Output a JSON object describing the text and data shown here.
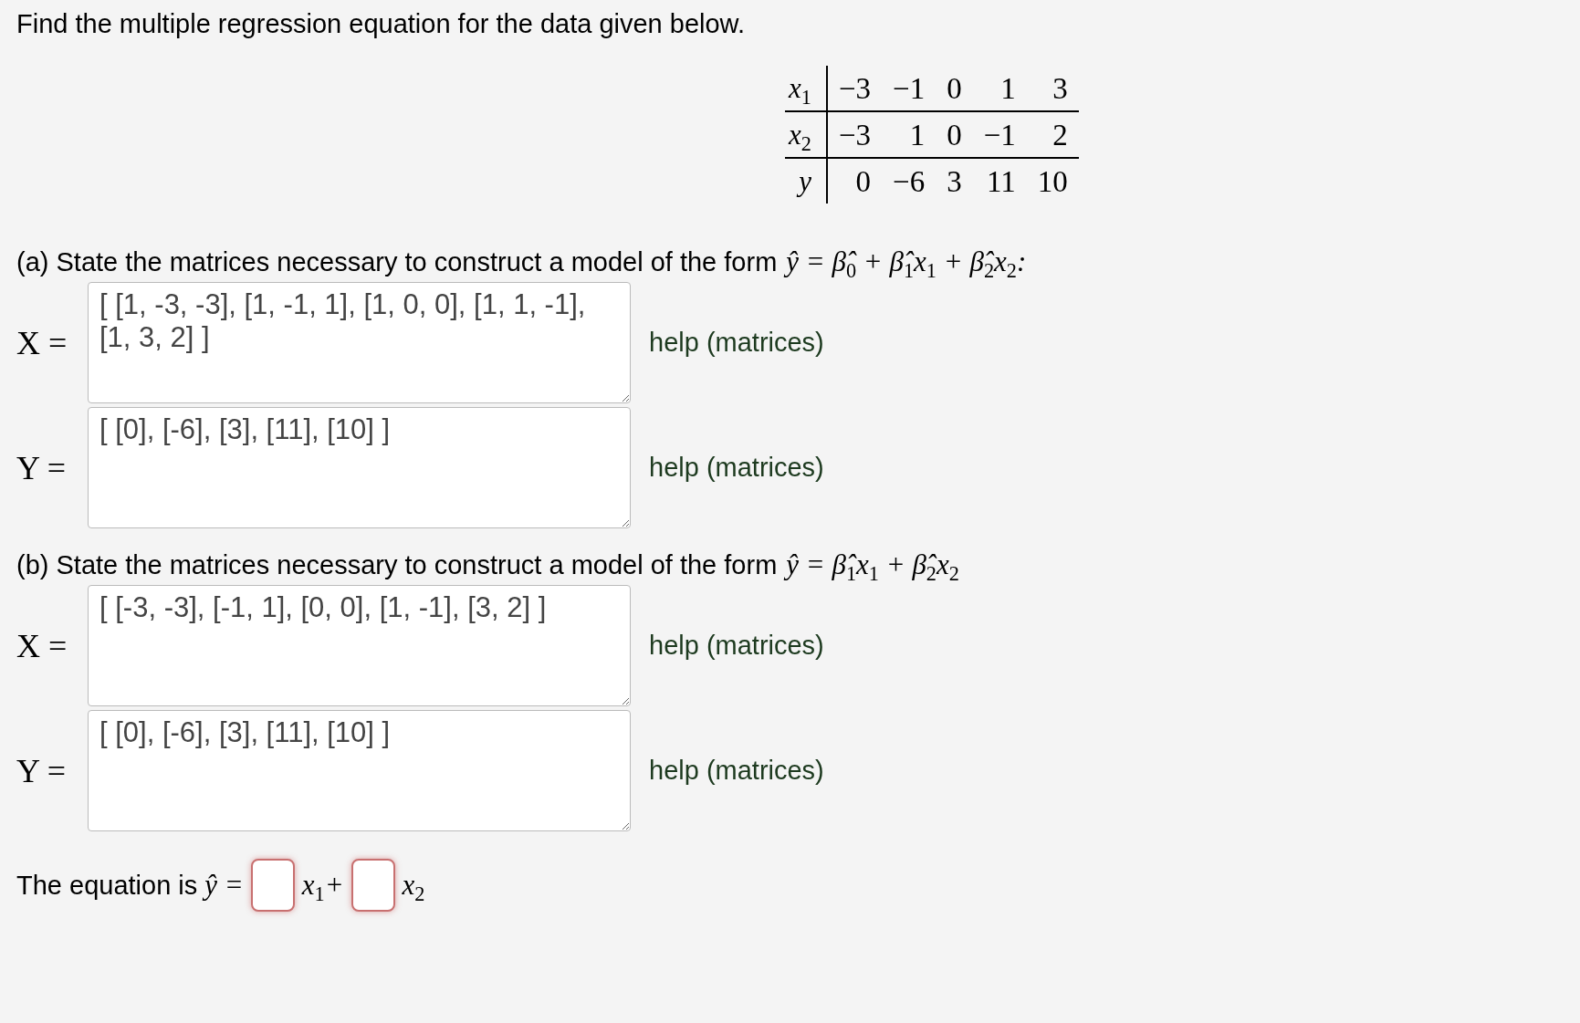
{
  "prompt": "Find the multiple regression equation for the data given below.",
  "table": {
    "rows": [
      {
        "label": "x$_{1}$",
        "cells": [
          "−3",
          "−1",
          "0",
          "1",
          "3"
        ]
      },
      {
        "label": "x$_{2}$",
        "cells": [
          "−3",
          "1",
          "0",
          "−1",
          "2"
        ]
      },
      {
        "label": "y",
        "cells": [
          "0",
          "−6",
          "3",
          "11",
          "10"
        ]
      }
    ]
  },
  "parts": [
    {
      "question": "(a) State the matrices necessary to construct a model of the form",
      "formula": "ŷ = β̂$_{0}$ + β̂$_{1}$x$_{1}$ + β̂$_{2}$x$_{2}$:",
      "matrices": [
        {
          "symbol": "X =",
          "value": "[ [1, -3, -3], [1, -1, 1], [1, 0, 0], [1, 1, -1], [1, 3, 2] ]",
          "help": "help (matrices)"
        },
        {
          "symbol": "Y =",
          "value": "[ [0], [-6], [3], [11], [10] ]",
          "help": "help (matrices)"
        }
      ]
    },
    {
      "question": "(b) State the matrices necessary to construct a model of the form",
      "formula": "ŷ = β̂$_{1}$x$_{1}$ + β̂$_{2}$x$_{2}$",
      "matrices": [
        {
          "symbol": "X =",
          "value": "[ [-3, -3], [-1, 1], [0, 0], [1, -1], [3, 2] ]",
          "help": "help (matrices)"
        },
        {
          "symbol": "Y =",
          "value": "[ [0], [-6], [3], [11], [10] ]",
          "help": "help (matrices)"
        }
      ]
    }
  ],
  "equation": {
    "lead": "The equation is",
    "formula": "ŷ =",
    "answers": [
      {
        "suffix": "x$_{1}$+"
      },
      {
        "suffix": "x$_{2}$"
      }
    ]
  }
}
